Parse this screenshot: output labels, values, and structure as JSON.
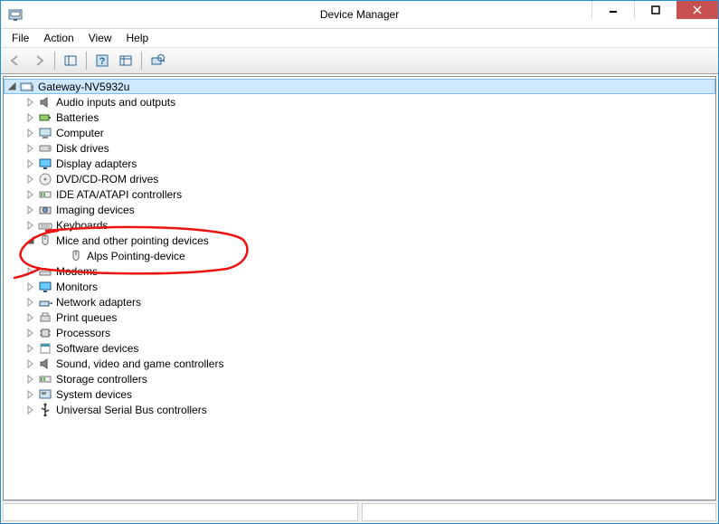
{
  "window": {
    "title": "Device Manager"
  },
  "menu": {
    "file": "File",
    "action": "Action",
    "view": "View",
    "help": "Help"
  },
  "tree": {
    "root": {
      "label": "Gateway-NV5932u",
      "expanded": true
    },
    "categories": [
      {
        "id": "audio",
        "label": "Audio inputs and outputs",
        "expanded": false
      },
      {
        "id": "batteries",
        "label": "Batteries",
        "expanded": false
      },
      {
        "id": "computer",
        "label": "Computer",
        "expanded": false
      },
      {
        "id": "disk",
        "label": "Disk drives",
        "expanded": false
      },
      {
        "id": "display",
        "label": "Display adapters",
        "expanded": false
      },
      {
        "id": "dvd",
        "label": "DVD/CD-ROM drives",
        "expanded": false
      },
      {
        "id": "ide",
        "label": "IDE ATA/ATAPI controllers",
        "expanded": false
      },
      {
        "id": "imaging",
        "label": "Imaging devices",
        "expanded": false
      },
      {
        "id": "keyboards",
        "label": "Keyboards",
        "expanded": false
      },
      {
        "id": "mice",
        "label": "Mice and other pointing devices",
        "expanded": true,
        "children": [
          {
            "id": "alps",
            "label": "Alps Pointing-device"
          }
        ]
      },
      {
        "id": "modems",
        "label": "Modems",
        "expanded": false
      },
      {
        "id": "monitors",
        "label": "Monitors",
        "expanded": false
      },
      {
        "id": "network",
        "label": "Network adapters",
        "expanded": false
      },
      {
        "id": "print",
        "label": "Print queues",
        "expanded": false
      },
      {
        "id": "processors",
        "label": "Processors",
        "expanded": false
      },
      {
        "id": "software",
        "label": "Software devices",
        "expanded": false
      },
      {
        "id": "sound",
        "label": "Sound, video and game controllers",
        "expanded": false
      },
      {
        "id": "storage",
        "label": "Storage controllers",
        "expanded": false
      },
      {
        "id": "system",
        "label": "System devices",
        "expanded": false
      },
      {
        "id": "usb",
        "label": "Universal Serial Bus controllers",
        "expanded": false
      }
    ]
  }
}
